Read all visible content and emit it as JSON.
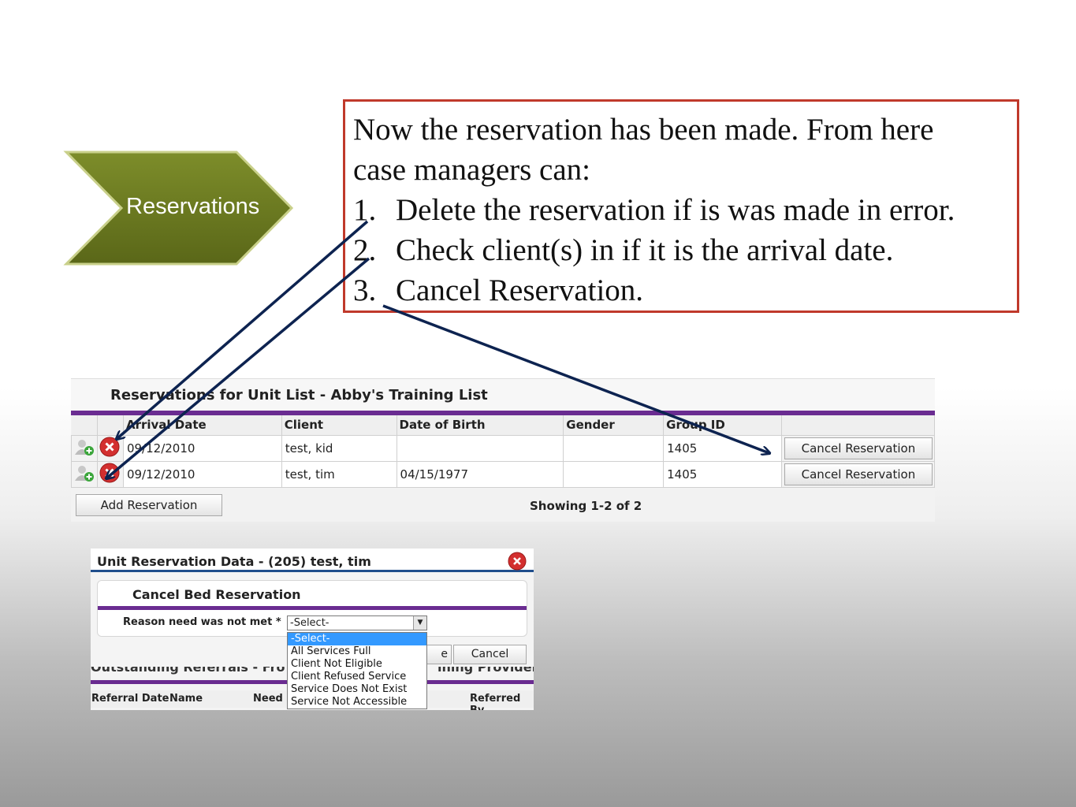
{
  "chevron": {
    "label": "Reservations"
  },
  "callout": {
    "intro_1": "Now the reservation has been made.  From here",
    "intro_2": "case managers can:",
    "items": [
      {
        "num": "1.",
        "text": "Delete the reservation if is was made in error."
      },
      {
        "num": "2.",
        "text": "Check client(s) in if it is the arrival date."
      },
      {
        "num": "3.",
        "text": "Cancel Reservation."
      }
    ]
  },
  "reservations": {
    "title": "Reservations for Unit List - Abby's Training List",
    "columns": [
      "Arrival Date",
      "Client",
      "Date of Birth",
      "Gender",
      "Group ID"
    ],
    "rows": [
      {
        "arrival": "09/12/2010",
        "client": "test, kid",
        "dob": "",
        "gender": "",
        "group": "1405",
        "action": "Cancel Reservation"
      },
      {
        "arrival": "09/12/2010",
        "client": "test, tim",
        "dob": "04/15/1977",
        "gender": "",
        "group": "1405",
        "action": "Cancel Reservation"
      }
    ],
    "add_button": "Add Reservation",
    "showing": "Showing 1-2 of 2"
  },
  "modal": {
    "title": "Unit Reservation Data - (205) test, tim",
    "section_title": "Cancel Bed Reservation",
    "reason_label": "Reason need was not met *",
    "select_value": "-Select-",
    "save_partial": "e",
    "cancel_button": "Cancel",
    "under_heading_left": "Outstanding Referrals - Fro",
    "under_heading_right": "ining Provider",
    "under_columns": [
      "Referral Date",
      "Name",
      "Need",
      "Referred By"
    ],
    "options": [
      "-Select-",
      "All Services Full",
      "Client Not Eligible",
      "Client Refused Service",
      "Service Does Not Exist",
      "Service Not Accessible"
    ]
  },
  "colors": {
    "chevron": "#6b7a1e",
    "callout_border": "#c0392b",
    "purple_bar": "#6a2c91",
    "arrow": "#0d2350",
    "delete_icon": "#d32f2f"
  },
  "icons": [
    "add-client-icon",
    "delete-icon",
    "close-icon",
    "chevron-down-icon"
  ]
}
